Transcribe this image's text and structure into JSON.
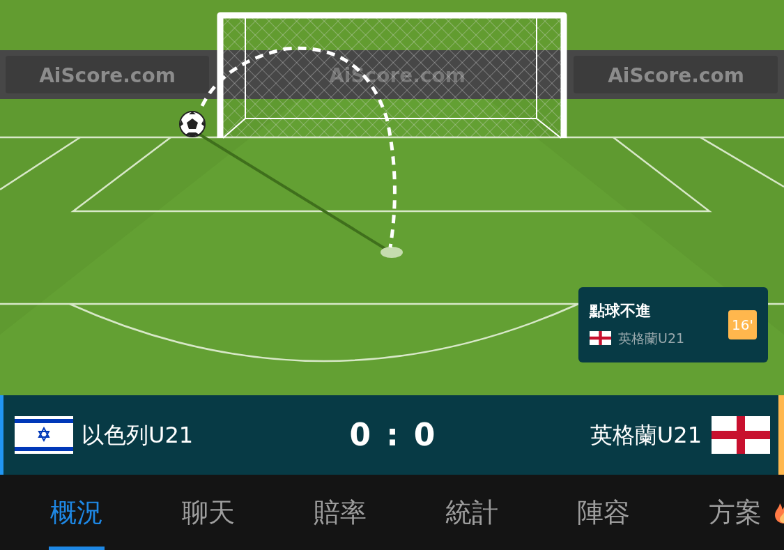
{
  "pitch": {
    "ad_boards": [
      {
        "text": "AiScore.com"
      },
      {
        "text": "AiScore.com"
      },
      {
        "text": "AiScore.com"
      }
    ]
  },
  "event_card": {
    "title": "點球不進",
    "team": {
      "name": "英格蘭U21",
      "kind": "england"
    },
    "minute": "16'"
  },
  "scoreboard": {
    "home": {
      "name": "以色列U21",
      "kind": "israel"
    },
    "home_score": "0",
    "separator": ":",
    "away_score": "0",
    "away": {
      "name": "英格蘭U21",
      "kind": "england"
    }
  },
  "tabs": [
    {
      "label": "概況",
      "selected": true,
      "hot": false
    },
    {
      "label": "聊天",
      "selected": false,
      "hot": false
    },
    {
      "label": "賠率",
      "selected": false,
      "hot": false
    },
    {
      "label": "統計",
      "selected": false,
      "hot": false
    },
    {
      "label": "陣容",
      "selected": false,
      "hot": false
    },
    {
      "label": "方案",
      "selected": false,
      "hot": true
    }
  ]
}
